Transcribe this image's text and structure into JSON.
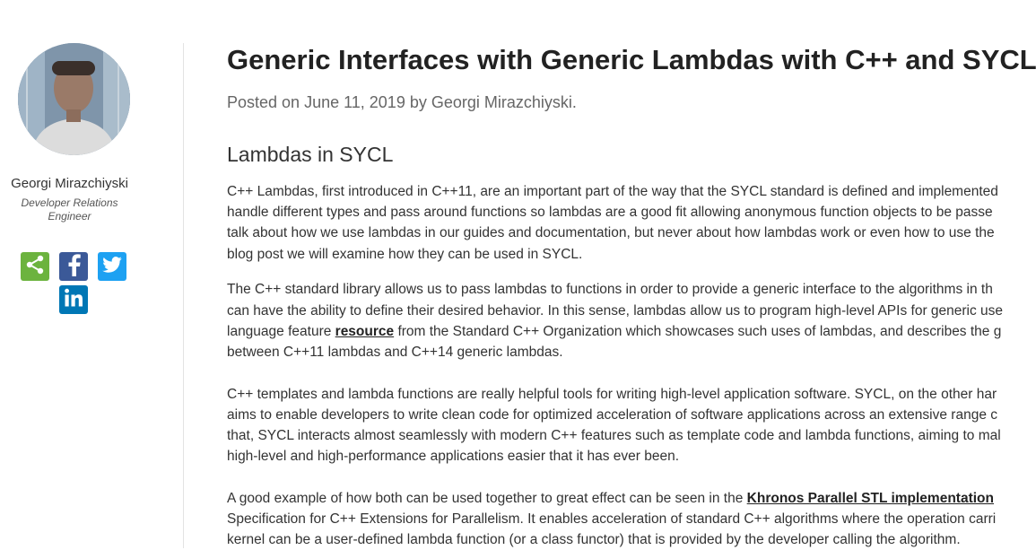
{
  "author": {
    "name": "Georgi Mirazchiyski",
    "title_line1": "Developer Relations",
    "title_line2": "Engineer"
  },
  "social_icons": [
    "share-icon",
    "facebook-icon",
    "twitter-icon",
    "linkedin-icon"
  ],
  "post": {
    "title": "Generic Interfaces with Generic Lambdas with C++ and SYCL",
    "meta": "Posted on June 11, 2019 by Georgi Mirazchiyski.",
    "section_heading": "Lambdas in SYCL",
    "p1": [
      "C++ Lambdas, first introduced in C++11, are an important part of the way that the SYCL standard is defined and implemented",
      "handle different types and pass around functions so lambdas are a good fit allowing anonymous function objects to be passe",
      "talk about how we use lambdas in our guides and documentation, but never about how lambdas work or even how to use the",
      "blog post we will examine how they can be used in SYCL."
    ],
    "p2": {
      "line1": "The C++ standard library allows us to pass lambdas to functions in order to provide a generic interface to the algorithms in th",
      "line2": "can have the ability to define their desired behavior. In this sense, lambdas allow us to program high-level APIs for generic use",
      "line3_before": "language feature ",
      "line3_link": "resource",
      "line3_after": " from the Standard C++ Organization which showcases such uses of lambdas, and describes the g",
      "line4": "between C++11 lambdas and C++14 generic lambdas."
    },
    "p3": [
      "C++ templates and lambda functions are really helpful tools for writing high-level application software. SYCL, on the other har",
      "aims to enable developers to write clean code for optimized acceleration of software applications across an extensive range c",
      "that, SYCL interacts almost seamlessly with modern C++ features such as template code and lambda functions, aiming to mal",
      "high-level and high-performance applications easier that it has ever been."
    ],
    "p4": {
      "line1_before": "A good example of how both can be used together to great effect can be seen in the ",
      "line1_link": "Khronos Parallel STL implementation",
      "line2": "Specification for C++ Extensions for Parallelism. It enables acceleration of standard C++ algorithms where the operation carri",
      "line3": "kernel can be a user-defined lambda function (or a class functor) that is provided by the developer calling the algorithm."
    }
  }
}
